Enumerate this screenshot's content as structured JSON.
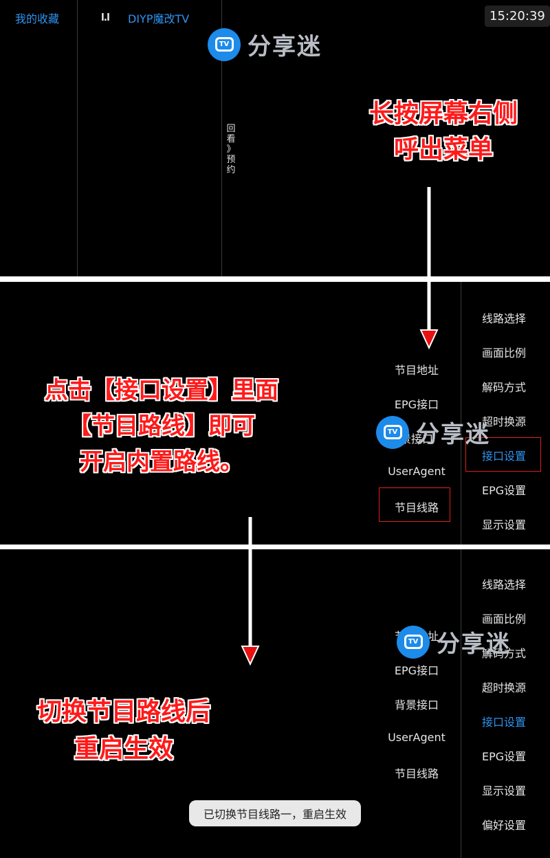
{
  "top": {
    "favorites": "我的收藏",
    "signal": "l.l",
    "channel_name": "DIYP魔改TV",
    "clock": "15:20:39",
    "vertical_chars": [
      "回",
      "看",
      "》",
      "预",
      "约"
    ]
  },
  "watermark": {
    "logo_text": "TV",
    "text": "分享迷"
  },
  "annotations": {
    "a1_line1": "长按屏幕右侧",
    "a1_line2": "呼出菜单",
    "a2_line1": "点击【接口设置】里面",
    "a2_line2": "【节目路线】即可",
    "a2_line3": "开启内置路线。",
    "a3_line1": "切换节目路线后",
    "a3_line2": "重启生效"
  },
  "menu": {
    "items": [
      "线路选择",
      "画面比例",
      "解码方式",
      "超时换源",
      "接口设置",
      "EPG设置",
      "显示设置",
      "偏好设置"
    ],
    "active": "接口设置"
  },
  "submenu": {
    "items": [
      "节目地址",
      "EPG接口",
      "背景接口",
      "UserAgent",
      "节目线路"
    ],
    "panel2_item3_visible": "景接口"
  },
  "toast": "已切换节目线路一，重启生效",
  "colors": {
    "accent": "#2f93f0",
    "annotation": "#ff1a1a",
    "arrow": "#e81010",
    "background": "#000000"
  }
}
